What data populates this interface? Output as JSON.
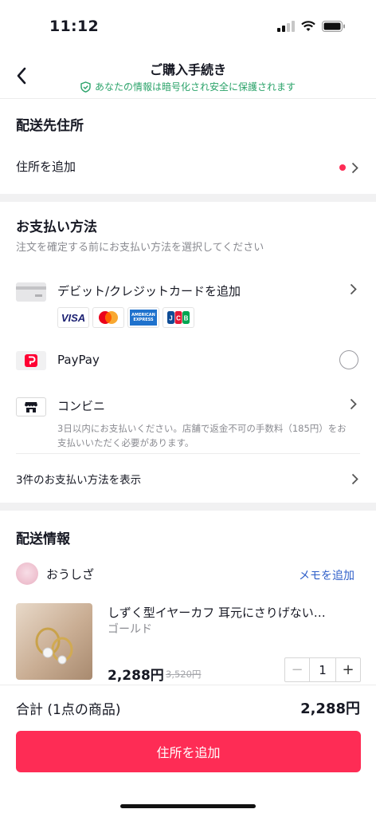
{
  "status": {
    "time": "11:12"
  },
  "nav": {
    "title": "ご購入手続き",
    "security_note": "あなたの情報は暗号化され安全に保護されます"
  },
  "shipping_address": {
    "title": "配送先住所",
    "add_label": "住所を追加"
  },
  "payment": {
    "title": "お支払い方法",
    "instruction": "注文を確定する前にお支払い方法を選択してください",
    "card": {
      "label": "デビット/クレジットカードを追加",
      "logos": [
        "VISA",
        "Mastercard",
        "AMERICAN EXPRESS",
        "JCB"
      ]
    },
    "paypay": {
      "label": "PayPay"
    },
    "konbini": {
      "label": "コンビニ",
      "note": "3日以内にお支払いください。店舗で返金不可の手数料（185円）をお支払いいただく必要があります。"
    },
    "more": "3件のお支払い方法を表示"
  },
  "delivery": {
    "title": "配送情報",
    "shop_name": "おうしざ",
    "memo_link": "メモを追加",
    "product": {
      "name": "しずく型イヤーカフ 耳元にさりげない…",
      "variant": "ゴールド",
      "price": "2,288円",
      "original_price": "3,520円",
      "quantity": "1"
    }
  },
  "footer": {
    "total_label": "合計 (1点の商品)",
    "total_value": "2,288円",
    "cta_label": "住所を追加"
  },
  "colors": {
    "accent": "#fe2c55",
    "secure_green": "#2ba36a",
    "link_blue": "#2f5fc9"
  }
}
